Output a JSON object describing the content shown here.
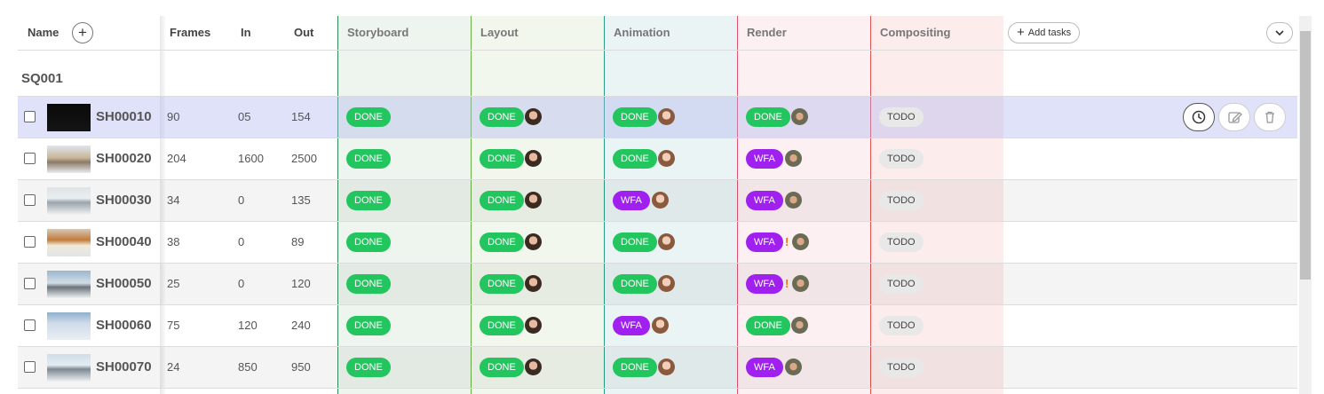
{
  "header": {
    "name_label": "Name",
    "frames_label": "Frames",
    "in_label": "In",
    "out_label": "Out",
    "task_columns": [
      {
        "label": "Storyboard",
        "color": "#2e8b57"
      },
      {
        "label": "Layout",
        "color": "#3c9a3c"
      },
      {
        "label": "Animation",
        "color": "#228b8b"
      },
      {
        "label": "Render",
        "color": "#e0526e"
      },
      {
        "label": "Compositing",
        "color": "#e05050"
      }
    ],
    "add_tasks_label": "Add tasks"
  },
  "sequence": {
    "name": "SQ001"
  },
  "status_colors": {
    "DONE": "#22c55e",
    "WFA": "#a020f0",
    "TODO": "#e8e8e8"
  },
  "shots": [
    {
      "name": "SH00010",
      "frames": "90",
      "in": "05",
      "out": "154",
      "tasks": [
        {
          "status": "DONE"
        },
        {
          "status": "DONE",
          "avatar": "female"
        },
        {
          "status": "DONE",
          "avatar": "female-2"
        },
        {
          "status": "DONE",
          "avatar": "male"
        },
        {
          "status": "TODO"
        }
      ]
    },
    {
      "name": "SH00020",
      "frames": "204",
      "in": "1600",
      "out": "2500",
      "tasks": [
        {
          "status": "DONE"
        },
        {
          "status": "DONE",
          "avatar": "female"
        },
        {
          "status": "DONE",
          "avatar": "female-2"
        },
        {
          "status": "WFA",
          "avatar": "male"
        },
        {
          "status": "TODO"
        }
      ]
    },
    {
      "name": "SH00030",
      "frames": "34",
      "in": "0",
      "out": "135",
      "tasks": [
        {
          "status": "DONE"
        },
        {
          "status": "DONE",
          "avatar": "female"
        },
        {
          "status": "WFA",
          "avatar": "female-2"
        },
        {
          "status": "WFA",
          "avatar": "male"
        },
        {
          "status": "TODO"
        }
      ]
    },
    {
      "name": "SH00040",
      "frames": "38",
      "in": "0",
      "out": "89",
      "tasks": [
        {
          "status": "DONE"
        },
        {
          "status": "DONE",
          "avatar": "female"
        },
        {
          "status": "DONE",
          "avatar": "female-2"
        },
        {
          "status": "WFA",
          "avatar": "male",
          "flag": "!"
        },
        {
          "status": "TODO"
        }
      ]
    },
    {
      "name": "SH00050",
      "frames": "25",
      "in": "0",
      "out": "120",
      "tasks": [
        {
          "status": "DONE"
        },
        {
          "status": "DONE",
          "avatar": "female"
        },
        {
          "status": "DONE",
          "avatar": "female-2"
        },
        {
          "status": "WFA",
          "avatar": "male",
          "flag": "!"
        },
        {
          "status": "TODO"
        }
      ]
    },
    {
      "name": "SH00060",
      "frames": "75",
      "in": "120",
      "out": "240",
      "tasks": [
        {
          "status": "DONE"
        },
        {
          "status": "DONE",
          "avatar": "female"
        },
        {
          "status": "WFA",
          "avatar": "female-2"
        },
        {
          "status": "DONE",
          "avatar": "male"
        },
        {
          "status": "TODO"
        }
      ]
    },
    {
      "name": "SH00070",
      "frames": "24",
      "in": "850",
      "out": "950",
      "tasks": [
        {
          "status": "DONE"
        },
        {
          "status": "DONE",
          "avatar": "female"
        },
        {
          "status": "DONE",
          "avatar": "female-2"
        },
        {
          "status": "WFA",
          "avatar": "male"
        },
        {
          "status": "TODO"
        }
      ]
    }
  ],
  "row_actions": [
    {
      "icon": "clock-icon",
      "label": "history"
    },
    {
      "icon": "edit-icon",
      "label": "edit"
    },
    {
      "icon": "trash-icon",
      "label": "delete"
    }
  ]
}
